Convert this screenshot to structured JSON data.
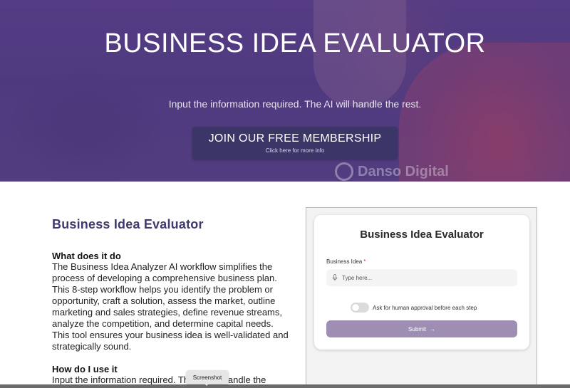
{
  "hero": {
    "title": "BUSINESS IDEA EVALUATOR",
    "subtitle": "Input the information required. The AI will handle the rest.",
    "cta_label": "JOIN OUR FREE MEMBERSHIP",
    "cta_sublabel": "Click here for more info",
    "watermark": "Danso Digital"
  },
  "content": {
    "section_title": "Business Idea Evaluator",
    "q1_heading": "What does it do",
    "q1_body": "The Business Idea Analyzer AI workflow simplifies the process of developing a comprehensive business plan. This 8-step workflow helps you identify the problem or opportunity, craft a solution, assess the market, outline marketing and sales strategies, define revenue streams, analyze the competition, and determine capital needs. This tool ensures your business idea is well-validated and strategically sound.",
    "q2_heading": "How do I use it",
    "q2_body": "Input the information required. The AI will handle the"
  },
  "form": {
    "title": "Business Idea Evaluator",
    "field_label": "Business Idea",
    "required_marker": "*",
    "field_placeholder": "Type here...",
    "field_value": "",
    "toggle_label": "Ask for human approval before each step",
    "toggle_on": false,
    "submit_label": "Submit",
    "submit_arrow": "→"
  },
  "tooltip": {
    "label": "Screenshot"
  },
  "icons": {
    "mic": "microphone-icon",
    "arrow": "arrow-right-icon",
    "logo": "danso-digital-logo"
  },
  "colors": {
    "accent": "#3e3a6e",
    "cta_bg": "#3c3568",
    "submit_bg": "#9f8eb4",
    "required": "#d12a2a"
  }
}
